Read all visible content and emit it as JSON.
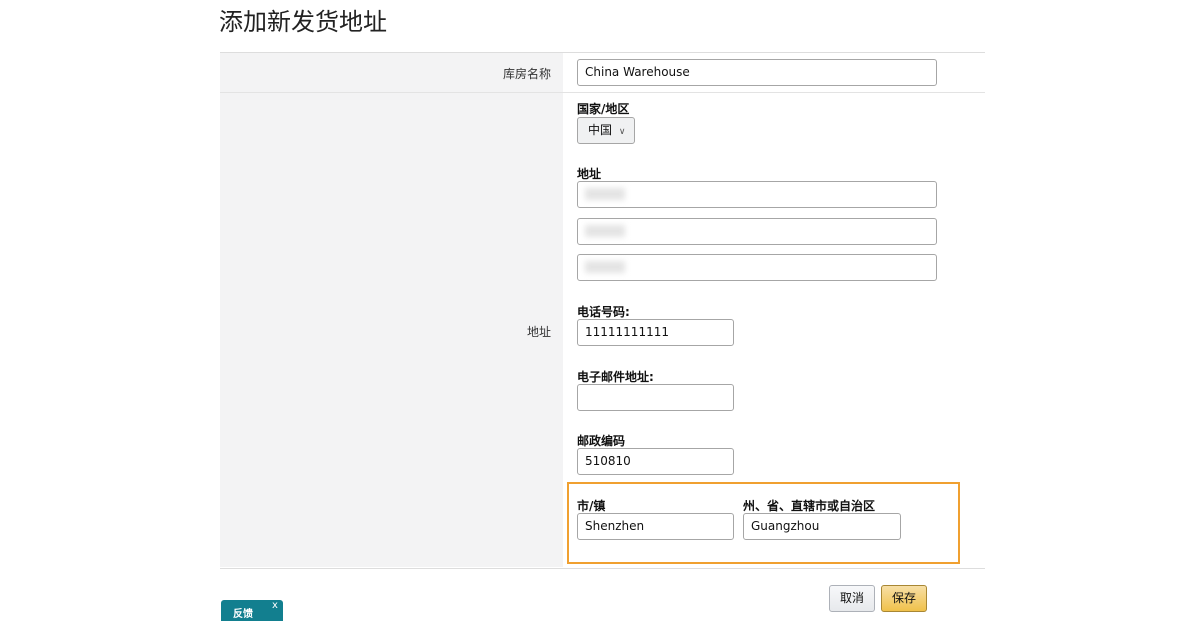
{
  "page_title": "添加新发货地址",
  "warehouse": {
    "label": "库房名称",
    "value": "China Warehouse"
  },
  "address_section": {
    "label": "地址"
  },
  "country": {
    "label": "国家/地区",
    "value": "中国"
  },
  "address": {
    "label": "地址"
  },
  "phone": {
    "label": "电话号码:",
    "value": "11111111111"
  },
  "email": {
    "label": "电子邮件地址:",
    "value": ""
  },
  "postal": {
    "label": "邮政编码",
    "value": "510810"
  },
  "city": {
    "label": "市/镇",
    "value": "Shenzhen"
  },
  "state": {
    "label": "州、省、直辖市或自治区",
    "value": "Guangzhou"
  },
  "buttons": {
    "cancel": "取消",
    "save": "保存"
  },
  "feedback": {
    "label": "反馈",
    "close": "x"
  },
  "colors": {
    "highlight": "#f0a030",
    "save": "#f0c14b",
    "feedback": "#127f8f"
  }
}
